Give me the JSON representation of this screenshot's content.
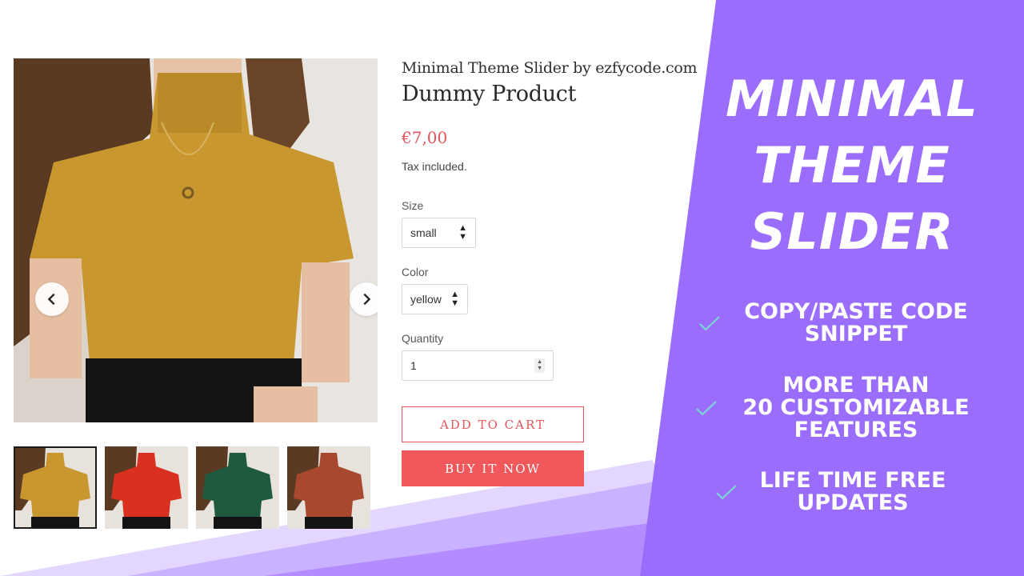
{
  "colors": {
    "purple_panel": "#9a6dfc",
    "lavender_light": "#e3d6ff",
    "lavender_mid": "#c9b2ff",
    "price_red": "#e2555b",
    "buy_button": "#f0585c",
    "check_teal": "#7ed3d6",
    "sweater_mustard": "#c8972f",
    "sweater_red": "#d9301f",
    "sweater_green": "#1e5a3e",
    "sweater_rust": "#a8492f"
  },
  "slider": {
    "prev_icon": "chevron-left-icon",
    "next_icon": "chevron-right-icon",
    "thumbnails": [
      {
        "label": "yellow",
        "active": true
      },
      {
        "label": "red",
        "active": false
      },
      {
        "label": "green",
        "active": false
      },
      {
        "label": "rust",
        "active": false
      }
    ]
  },
  "product": {
    "vendor": "Minimal Theme Slider by ezfycode.com",
    "title": "Dummy Product",
    "price": "€7,00",
    "tax_note": "Tax included.",
    "size_label": "Size",
    "size_value": "small",
    "color_label": "Color",
    "color_value": "yellow",
    "quantity_label": "Quantity",
    "quantity_value": "1",
    "add_to_cart": "ADD TO CART",
    "buy_now": "BUY IT NOW"
  },
  "promo": {
    "title_lines": [
      "MINIMAL",
      "THEME",
      "SLIDER"
    ],
    "features": [
      {
        "lines": [
          "COPY/PASTE CODE",
          "SNIPPET"
        ],
        "icon": "check-icon"
      },
      {
        "lines": [
          "MORE THAN",
          "20 CUSTOMIZABLE",
          "FEATURES"
        ],
        "icon": "check-icon"
      },
      {
        "lines": [
          "LIFE TIME FREE",
          "UPDATES"
        ],
        "icon": "check-icon"
      }
    ]
  }
}
